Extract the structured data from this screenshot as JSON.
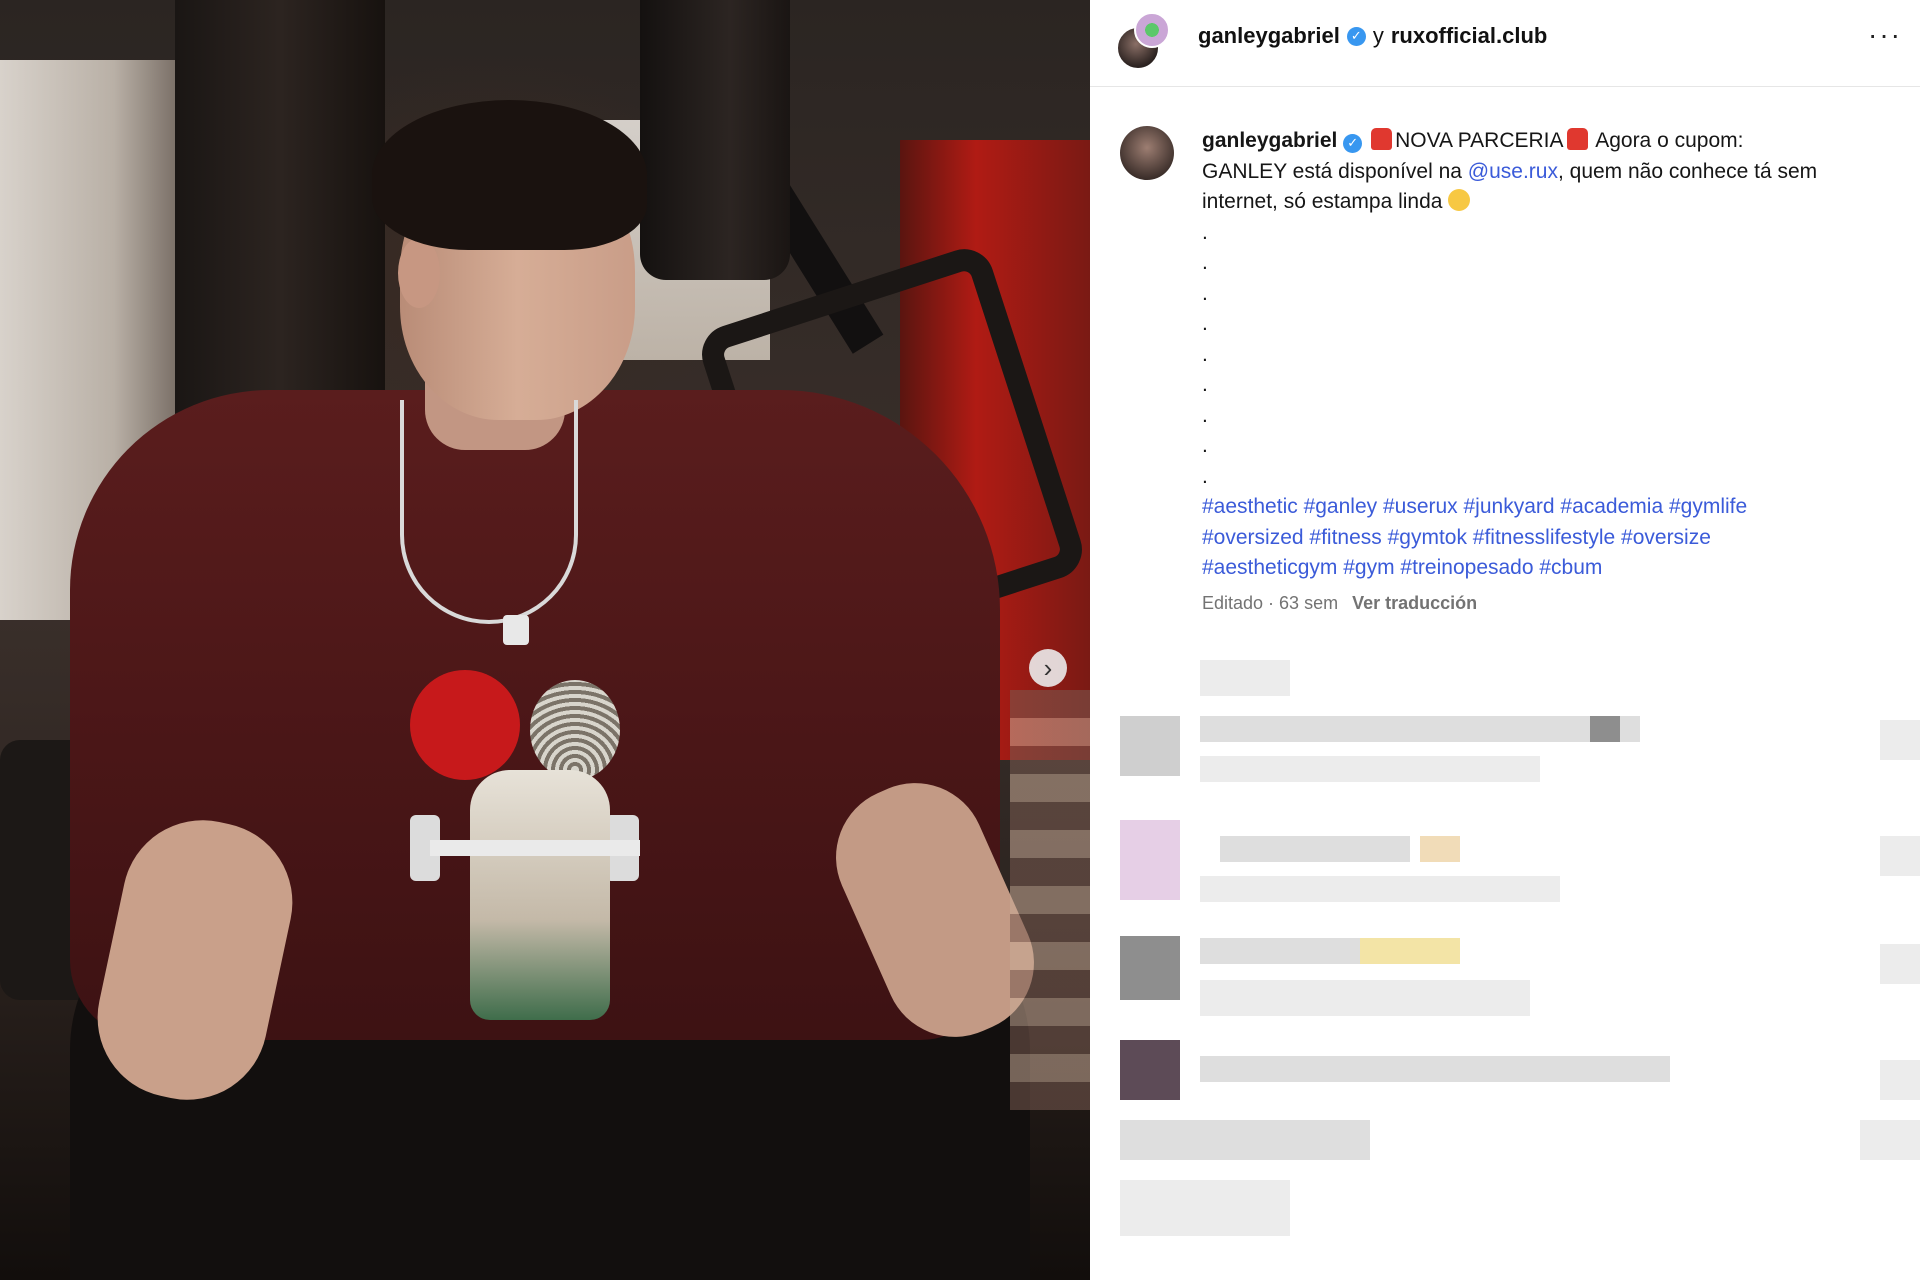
{
  "post": {
    "header": {
      "author": "ganleygabriel",
      "conjunction": "y",
      "collaborator": "ruxofficial.club",
      "verified_icon": "verified-badge-icon",
      "more_label": "···"
    },
    "caption": {
      "author": "ganleygabriel",
      "line1_a": "NOVA PARCERIA",
      "line1_b": "Agora o cupom:",
      "line2_a": "GANLEY está disponível na",
      "mention": "@use.rux",
      "line2_b": ", quem não conhece tá sem",
      "line3": "internet, só estampa linda",
      "dots": [
        ".",
        ".",
        ".",
        ".",
        ".",
        ".",
        ".",
        ".",
        "."
      ],
      "hashtags_line1": "#aesthetic #ganley #userux #junkyard #academia #gymlife",
      "hashtags_line2": "#oversized #fitness #gymtok #fitnesslifestyle #oversize",
      "hashtags_line3": "#aestheticgym #gym #treinopesado #cbum"
    },
    "meta": {
      "edited": "Editado · 63 sem",
      "translate": "Ver traducción"
    },
    "media": {
      "next_label": "›"
    },
    "colors": {
      "link": "#3b5bd9",
      "verified": "#3897f0",
      "meta_gray": "#737373"
    }
  }
}
